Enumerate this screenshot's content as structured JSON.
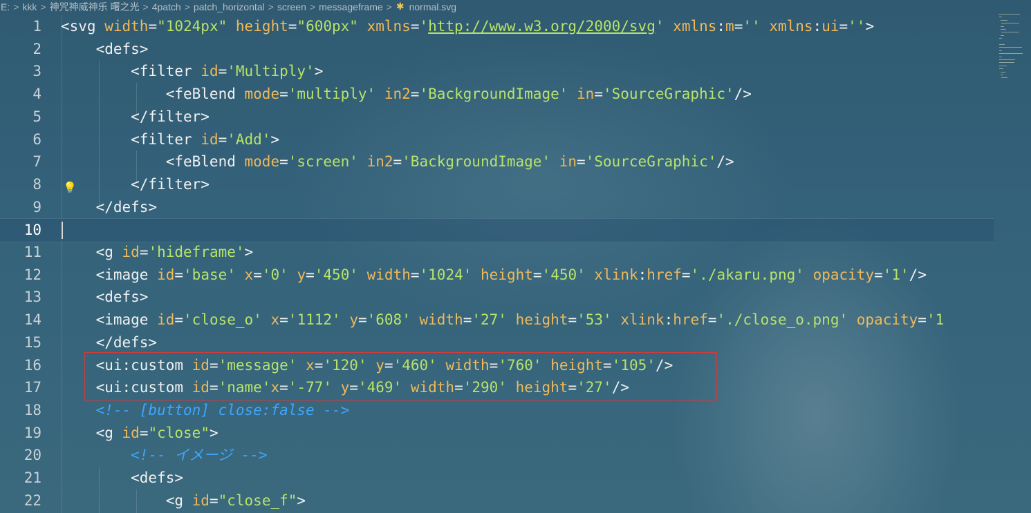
{
  "breadcrumb": {
    "items": [
      "E:",
      "kkk",
      "神咒神威神乐 曙之光",
      "4patch",
      "patch_horizontal",
      "screen",
      "messageframe"
    ],
    "file": "normal.svg",
    "file_icon": "svg-file-icon"
  },
  "editor": {
    "current_line": 10,
    "lines": [
      {
        "n": "1",
        "segs": [
          [
            "tag",
            "<svg "
          ],
          [
            "attr",
            "width"
          ],
          [
            "tag",
            "="
          ],
          [
            "val",
            "\"1024px\""
          ],
          [
            "tag",
            " "
          ],
          [
            "attr",
            "height"
          ],
          [
            "tag",
            "="
          ],
          [
            "val",
            "\"600px\""
          ],
          [
            "tag",
            " "
          ],
          [
            "attr",
            "xmlns"
          ],
          [
            "tag",
            "="
          ],
          [
            "val",
            "'"
          ],
          [
            "link",
            "http://www.w3.org/2000/svg"
          ],
          [
            "val",
            "'"
          ],
          [
            "tag",
            " "
          ],
          [
            "attr",
            "xmlns"
          ],
          [
            "tag",
            ":"
          ],
          [
            "attr",
            "m"
          ],
          [
            "tag",
            "="
          ],
          [
            "val",
            "''"
          ],
          [
            "tag",
            " "
          ],
          [
            "attr",
            "xmlns"
          ],
          [
            "tag",
            ":"
          ],
          [
            "attr",
            "ui"
          ],
          [
            "tag",
            "="
          ],
          [
            "val",
            "''"
          ],
          [
            "tag",
            ">"
          ]
        ]
      },
      {
        "n": "2",
        "segs": [
          [
            "tag",
            "    <defs>"
          ]
        ]
      },
      {
        "n": "3",
        "segs": [
          [
            "tag",
            "        <filter "
          ],
          [
            "attr",
            "id"
          ],
          [
            "tag",
            "="
          ],
          [
            "val",
            "'Multiply'"
          ],
          [
            "tag",
            ">"
          ]
        ]
      },
      {
        "n": "4",
        "segs": [
          [
            "tag",
            "            <feBlend "
          ],
          [
            "attr",
            "mode"
          ],
          [
            "tag",
            "="
          ],
          [
            "val",
            "'multiply'"
          ],
          [
            "tag",
            " "
          ],
          [
            "attr",
            "in2"
          ],
          [
            "tag",
            "="
          ],
          [
            "val",
            "'BackgroundImage'"
          ],
          [
            "tag",
            " "
          ],
          [
            "attr",
            "in"
          ],
          [
            "tag",
            "="
          ],
          [
            "val",
            "'SourceGraphic'"
          ],
          [
            "tag",
            "/>"
          ]
        ]
      },
      {
        "n": "5",
        "segs": [
          [
            "tag",
            "        </filter>"
          ]
        ]
      },
      {
        "n": "6",
        "segs": [
          [
            "tag",
            "        <filter "
          ],
          [
            "attr",
            "id"
          ],
          [
            "tag",
            "="
          ],
          [
            "val",
            "'Add'"
          ],
          [
            "tag",
            ">"
          ]
        ]
      },
      {
        "n": "7",
        "segs": [
          [
            "tag",
            "            <feBlend "
          ],
          [
            "attr",
            "mode"
          ],
          [
            "tag",
            "="
          ],
          [
            "val",
            "'screen'"
          ],
          [
            "tag",
            " "
          ],
          [
            "attr",
            "in2"
          ],
          [
            "tag",
            "="
          ],
          [
            "val",
            "'BackgroundImage'"
          ],
          [
            "tag",
            " "
          ],
          [
            "attr",
            "in"
          ],
          [
            "tag",
            "="
          ],
          [
            "val",
            "'SourceGraphic'"
          ],
          [
            "tag",
            "/>"
          ]
        ]
      },
      {
        "n": "8",
        "segs": [
          [
            "tag",
            "        </filter>"
          ]
        ]
      },
      {
        "n": "9",
        "segs": [
          [
            "tag",
            "    </defs>"
          ]
        ]
      },
      {
        "n": "10",
        "segs": []
      },
      {
        "n": "11",
        "segs": [
          [
            "tag",
            "    <g "
          ],
          [
            "attr",
            "id"
          ],
          [
            "tag",
            "="
          ],
          [
            "val",
            "'hideframe'"
          ],
          [
            "tag",
            ">"
          ]
        ]
      },
      {
        "n": "12",
        "segs": [
          [
            "tag",
            "    <image "
          ],
          [
            "attr",
            "id"
          ],
          [
            "tag",
            "="
          ],
          [
            "val",
            "'base'"
          ],
          [
            "tag",
            " "
          ],
          [
            "attr",
            "x"
          ],
          [
            "tag",
            "="
          ],
          [
            "val",
            "'0'"
          ],
          [
            "tag",
            " "
          ],
          [
            "attr",
            "y"
          ],
          [
            "tag",
            "="
          ],
          [
            "val",
            "'450'"
          ],
          [
            "tag",
            " "
          ],
          [
            "attr",
            "width"
          ],
          [
            "tag",
            "="
          ],
          [
            "val",
            "'1024'"
          ],
          [
            "tag",
            " "
          ],
          [
            "attr",
            "height"
          ],
          [
            "tag",
            "="
          ],
          [
            "val",
            "'450'"
          ],
          [
            "tag",
            " "
          ],
          [
            "attr",
            "xlink"
          ],
          [
            "tag",
            ":"
          ],
          [
            "attr",
            "href"
          ],
          [
            "tag",
            "="
          ],
          [
            "val",
            "'./akaru.png'"
          ],
          [
            "tag",
            " "
          ],
          [
            "attr",
            "opacity"
          ],
          [
            "tag",
            "="
          ],
          [
            "val",
            "'1'"
          ],
          [
            "tag",
            "/>"
          ]
        ]
      },
      {
        "n": "13",
        "segs": [
          [
            "tag",
            "    <defs>"
          ]
        ]
      },
      {
        "n": "14",
        "segs": [
          [
            "tag",
            "    <image "
          ],
          [
            "attr",
            "id"
          ],
          [
            "tag",
            "="
          ],
          [
            "val",
            "'close_o'"
          ],
          [
            "tag",
            " "
          ],
          [
            "attr",
            "x"
          ],
          [
            "tag",
            "="
          ],
          [
            "val",
            "'1112'"
          ],
          [
            "tag",
            " "
          ],
          [
            "attr",
            "y"
          ],
          [
            "tag",
            "="
          ],
          [
            "val",
            "'608'"
          ],
          [
            "tag",
            " "
          ],
          [
            "attr",
            "width"
          ],
          [
            "tag",
            "="
          ],
          [
            "val",
            "'27'"
          ],
          [
            "tag",
            " "
          ],
          [
            "attr",
            "height"
          ],
          [
            "tag",
            "="
          ],
          [
            "val",
            "'53'"
          ],
          [
            "tag",
            " "
          ],
          [
            "attr",
            "xlink"
          ],
          [
            "tag",
            ":"
          ],
          [
            "attr",
            "href"
          ],
          [
            "tag",
            "="
          ],
          [
            "val",
            "'./close_o.png'"
          ],
          [
            "tag",
            " "
          ],
          [
            "attr",
            "opacity"
          ],
          [
            "tag",
            "="
          ],
          [
            "val",
            "'1"
          ]
        ]
      },
      {
        "n": "15",
        "segs": [
          [
            "tag",
            "    </defs>"
          ]
        ]
      },
      {
        "n": "16",
        "segs": [
          [
            "tag",
            "    <ui:custom "
          ],
          [
            "attr",
            "id"
          ],
          [
            "tag",
            "="
          ],
          [
            "val",
            "'message'"
          ],
          [
            "tag",
            " "
          ],
          [
            "attr",
            "x"
          ],
          [
            "tag",
            "="
          ],
          [
            "val",
            "'120'"
          ],
          [
            "tag",
            " "
          ],
          [
            "attr",
            "y"
          ],
          [
            "tag",
            "="
          ],
          [
            "val",
            "'460'"
          ],
          [
            "tag",
            " "
          ],
          [
            "attr",
            "width"
          ],
          [
            "tag",
            "="
          ],
          [
            "val",
            "'760'"
          ],
          [
            "tag",
            " "
          ],
          [
            "attr",
            "height"
          ],
          [
            "tag",
            "="
          ],
          [
            "val",
            "'105'"
          ],
          [
            "tag",
            "/>"
          ]
        ]
      },
      {
        "n": "17",
        "segs": [
          [
            "tag",
            "    <ui:custom "
          ],
          [
            "attr",
            "id"
          ],
          [
            "tag",
            "="
          ],
          [
            "val",
            "'name'"
          ],
          [
            "attr",
            "x"
          ],
          [
            "tag",
            "="
          ],
          [
            "val",
            "'-77'"
          ],
          [
            "tag",
            " "
          ],
          [
            "attr",
            "y"
          ],
          [
            "tag",
            "="
          ],
          [
            "val",
            "'469'"
          ],
          [
            "tag",
            " "
          ],
          [
            "attr",
            "width"
          ],
          [
            "tag",
            "="
          ],
          [
            "val",
            "'290'"
          ],
          [
            "tag",
            " "
          ],
          [
            "attr",
            "height"
          ],
          [
            "tag",
            "="
          ],
          [
            "val",
            "'27'"
          ],
          [
            "tag",
            "/>"
          ]
        ]
      },
      {
        "n": "18",
        "segs": [
          [
            "tag",
            "    "
          ],
          [
            "cmt",
            "<!-- [button] close:false -->"
          ]
        ]
      },
      {
        "n": "19",
        "segs": [
          [
            "tag",
            "    <g "
          ],
          [
            "attr",
            "id"
          ],
          [
            "tag",
            "="
          ],
          [
            "val",
            "\"close\""
          ],
          [
            "tag",
            ">"
          ]
        ]
      },
      {
        "n": "20",
        "segs": [
          [
            "tag",
            "        "
          ],
          [
            "cmt",
            "<!-- イメージ -->"
          ]
        ]
      },
      {
        "n": "21",
        "segs": [
          [
            "tag",
            "        <defs>"
          ]
        ]
      },
      {
        "n": "22",
        "segs": [
          [
            "tag",
            "            <g "
          ],
          [
            "attr",
            "id"
          ],
          [
            "tag",
            "="
          ],
          [
            "val",
            "\"close_f\""
          ],
          [
            "tag",
            ">"
          ]
        ]
      }
    ]
  },
  "colors": {
    "tag": "#f1f1f1",
    "attribute": "#f0b95a",
    "value": "#b7e36a",
    "comment": "#3ea6ff",
    "highlight_box": "#d33a3a",
    "lightbulb": "#f5d04d"
  },
  "icons": {
    "lightbulb": "lightbulb-icon",
    "breadcrumb_separator": "chevron-right-icon"
  }
}
